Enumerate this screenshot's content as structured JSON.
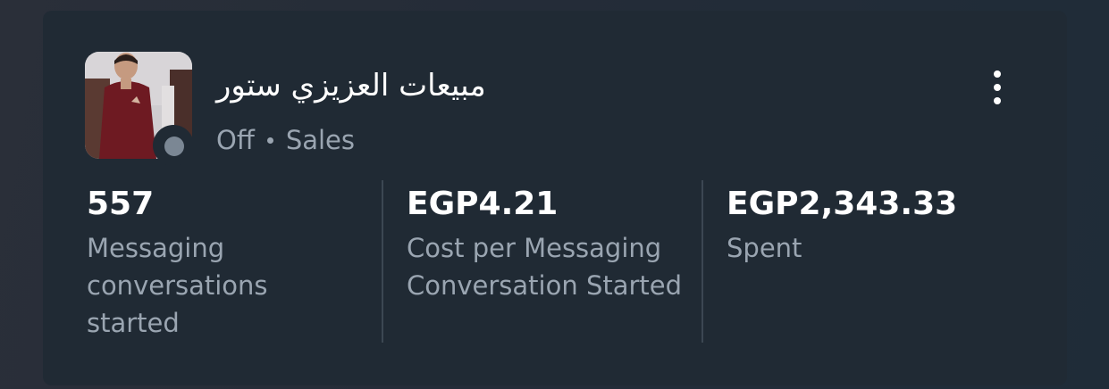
{
  "account": {
    "name": "مبيعات العزيزي ستور",
    "status": "Off",
    "category": "Sales"
  },
  "metrics": [
    {
      "value": "557",
      "label": "Messaging conversations started"
    },
    {
      "value": "EGP4.21",
      "label": "Cost per Messaging Conversation Started"
    },
    {
      "value": "EGP2,343.33",
      "label": "Spent"
    }
  ],
  "menu": {
    "icon": "more-vertical-icon"
  },
  "colors": {
    "card_bg": "#202a34",
    "text_primary": "#ffffff",
    "text_secondary": "#9aa5b1",
    "status_off": "#7b8794"
  }
}
